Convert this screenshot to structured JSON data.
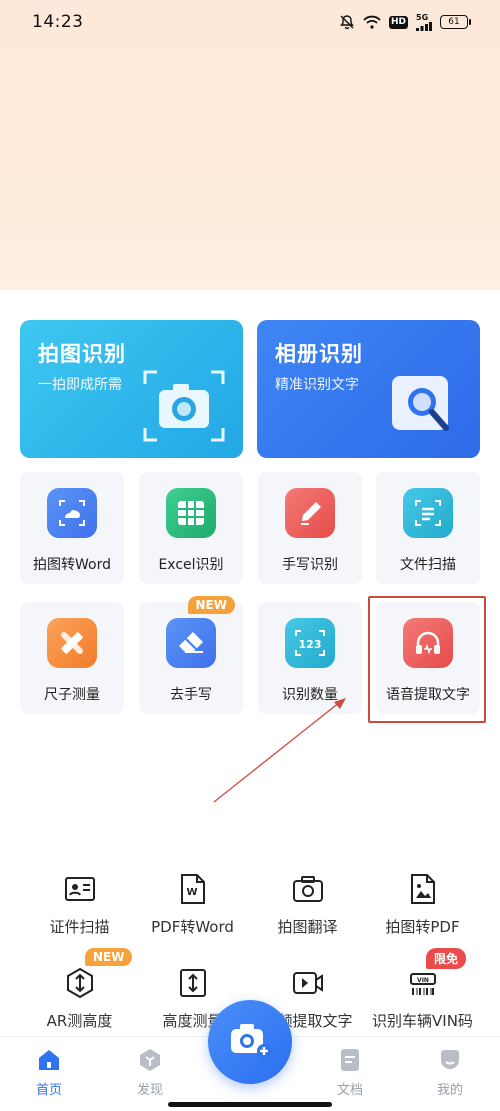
{
  "status_bar": {
    "time": "14:23",
    "network": "5G",
    "hd": "HD",
    "battery": "61",
    "icons": [
      "bell-off-icon",
      "wifi-icon",
      "hd-icon",
      "signal-icon",
      "battery-icon"
    ]
  },
  "feature_cards": [
    {
      "title": "拍图识别",
      "subtitle": "一拍即成所需",
      "icon": "camera-scan-icon",
      "color": "#2bb3ea"
    },
    {
      "title": "相册识别",
      "subtitle": "精准识别文字",
      "icon": "album-search-icon",
      "color": "#3578ee"
    }
  ],
  "grid_row1": [
    {
      "label": "拍图转Word",
      "icon": "photo-to-word-icon",
      "color": "#3f7df2"
    },
    {
      "label": "Excel识别",
      "icon": "excel-table-icon",
      "color": "#25b77a"
    },
    {
      "label": "手写识别",
      "icon": "handwriting-pen-icon",
      "color": "#ee5a5a"
    },
    {
      "label": "文件扫描",
      "icon": "document-scan-icon",
      "color": "#2bb5d6"
    }
  ],
  "grid_row2": [
    {
      "label": "尺子测量",
      "icon": "ruler-icon",
      "color": "#f58b35"
    },
    {
      "label": "去手写",
      "icon": "eraser-icon",
      "color": "#3f7df2",
      "badge": "NEW"
    },
    {
      "label": "识别数量",
      "icon": "count-123-icon",
      "color": "#2bb5d6"
    },
    {
      "label": "语音提取文字",
      "icon": "headphones-icon",
      "color": "#ee5a5a"
    }
  ],
  "tools_row1": [
    {
      "label": "证件扫描",
      "icon": "id-card-icon"
    },
    {
      "label": "PDF转Word",
      "icon": "pdf-to-word-icon"
    },
    {
      "label": "拍图翻译",
      "icon": "photo-translate-icon"
    },
    {
      "label": "拍图转PDF",
      "icon": "photo-to-pdf-icon"
    }
  ],
  "tools_row2": [
    {
      "label": "AR测高度",
      "icon": "ar-height-icon",
      "badge": "NEW"
    },
    {
      "label": "高度测量",
      "icon": "height-measure-icon"
    },
    {
      "label": "视频提取文字",
      "icon": "video-extract-icon"
    },
    {
      "label": "识别车辆VIN码",
      "icon": "vin-code-icon",
      "badge": "限免"
    }
  ],
  "bottom_nav": [
    {
      "label": "首页",
      "icon": "home-icon",
      "active": true
    },
    {
      "label": "发现",
      "icon": "discover-icon",
      "active": false
    },
    {
      "label": "文档",
      "icon": "document-icon",
      "active": false
    },
    {
      "label": "我的",
      "icon": "profile-icon",
      "active": false
    }
  ],
  "colors": {
    "accent": "#2f73f1",
    "badge_orange": "#f6a13a",
    "badge_red": "#ea4b4b",
    "annotation": "#cf4a3e"
  }
}
